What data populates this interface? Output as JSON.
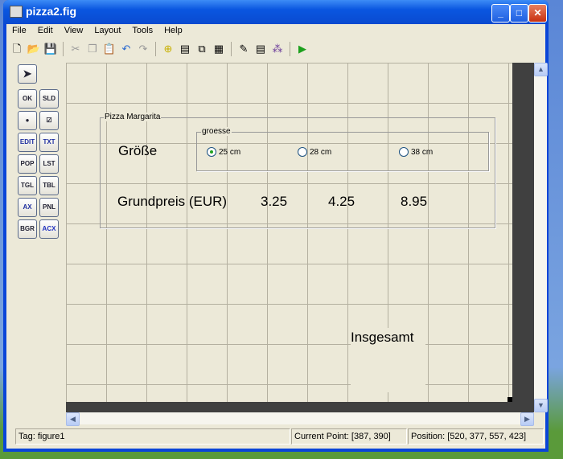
{
  "window": {
    "title": "pizza2.fig"
  },
  "menu": [
    "File",
    "Edit",
    "View",
    "Layout",
    "Tools",
    "Help"
  ],
  "palette": [
    "OK",
    "SLD",
    "RB",
    "CHK",
    "EDIT",
    "TXT",
    "POP",
    "LST",
    "TGL",
    "TBL",
    "AX",
    "PNL",
    "BGR",
    "ACX"
  ],
  "panel": {
    "title": "Pizza Margarita",
    "size_label": "Größe",
    "price_label": "Grundpreis (EUR)",
    "prices": [
      "3.25",
      "4.25",
      "8.95"
    ]
  },
  "group": {
    "title": "groesse",
    "options": [
      "25 cm",
      "28 cm",
      "38 cm"
    ],
    "selected": "25 cm"
  },
  "total_label": "Insgesamt",
  "status": {
    "tag": "Tag: figure1",
    "current_point": "Current Point:  [387, 390]",
    "position": "Position: [520, 377, 557, 423]"
  }
}
